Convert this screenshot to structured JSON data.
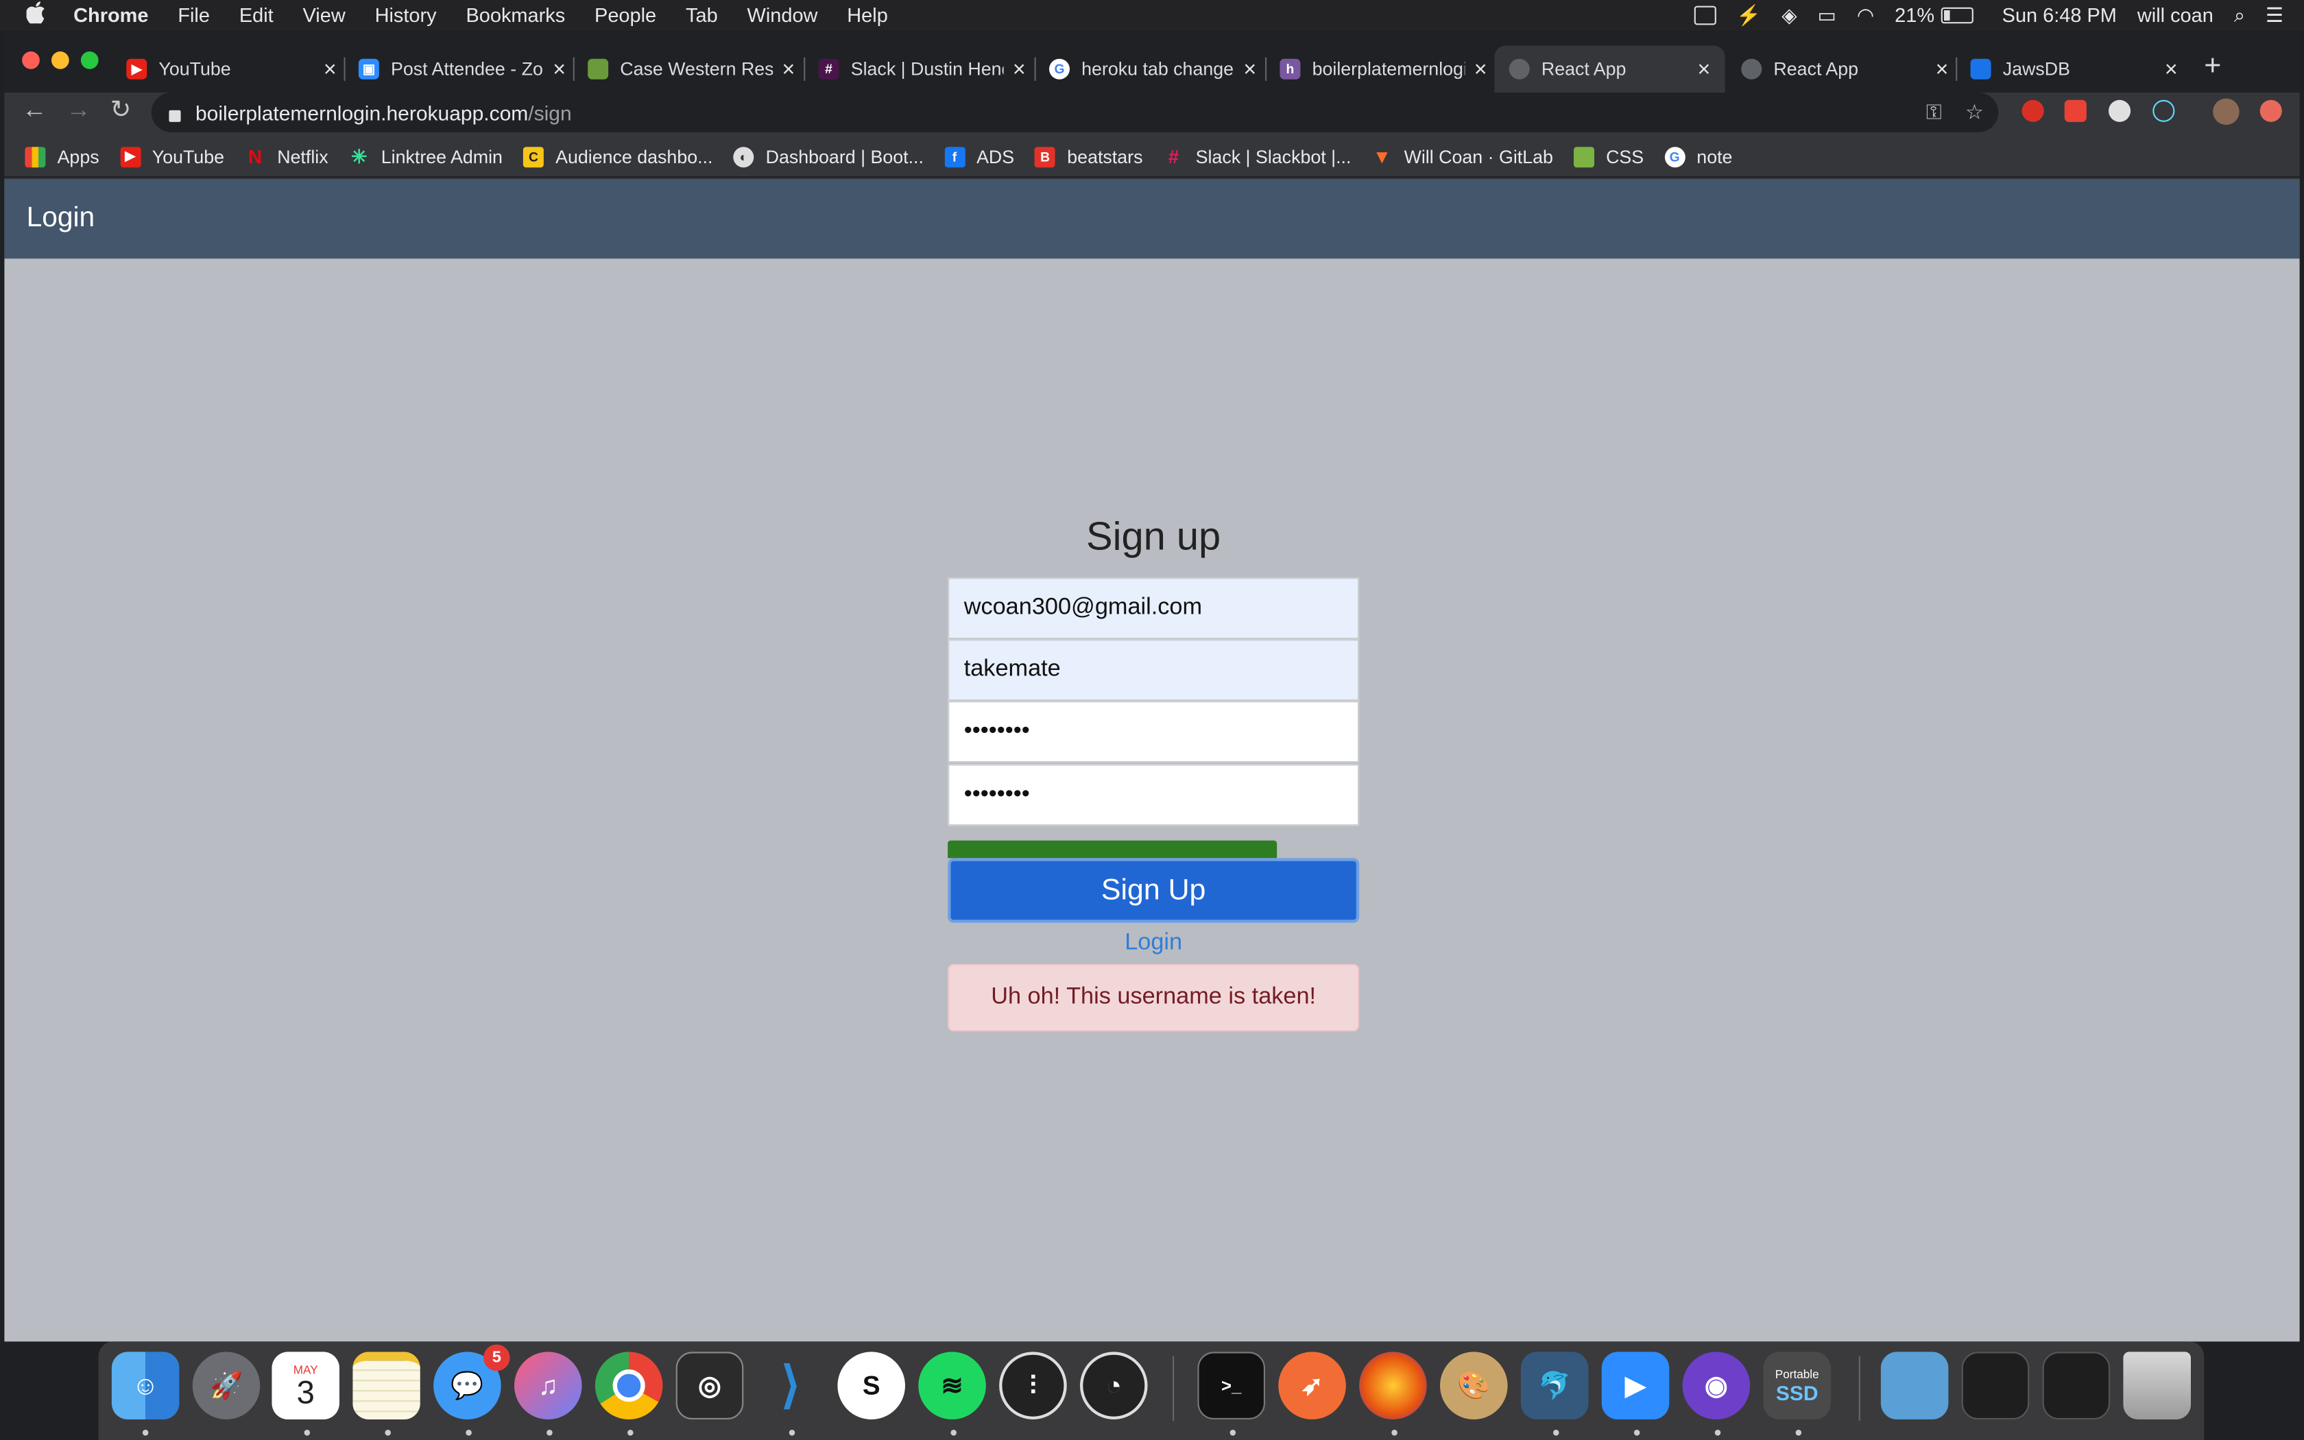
{
  "menubar": {
    "app_name": "Chrome",
    "menus": [
      "File",
      "Edit",
      "View",
      "History",
      "Bookmarks",
      "People",
      "Tab",
      "Window",
      "Help"
    ],
    "battery": "21%",
    "clock": "Sun 6:48 PM",
    "user": "will coan"
  },
  "tabs": [
    {
      "title": "YouTube",
      "icon": "youtube-icon",
      "color": "#e62117"
    },
    {
      "title": "Post Attendee - Zoom",
      "icon": "zoom-icon",
      "color": "#2d8cff"
    },
    {
      "title": "Case Western Reserve",
      "icon": "cwru-icon",
      "color": "#6a9a3a"
    },
    {
      "title": "Slack | Dustin Henderson",
      "icon": "slack-icon",
      "color": "#4a154b"
    },
    {
      "title": "heroku tab change",
      "icon": "google-icon",
      "color": "#ffffff"
    },
    {
      "title": "boilerplatemernlogin",
      "icon": "heroku-icon",
      "color": "#79589f"
    },
    {
      "title": "React App",
      "icon": "globe-icon",
      "color": "#5f6368"
    },
    {
      "title": "React App",
      "icon": "globe-icon",
      "color": "#5f6368"
    },
    {
      "title": "JawsDB",
      "icon": "jawsdb-icon",
      "color": "#1a73e8"
    }
  ],
  "address": {
    "host": "boilerplatemernlogin.herokuapp.com",
    "path": "/sign"
  },
  "bookmarks": [
    {
      "label": "Apps",
      "icon": "apps-grid-icon",
      "color": "#e8710a"
    },
    {
      "label": "YouTube",
      "icon": "youtube-icon",
      "color": "#e62117"
    },
    {
      "label": "Netflix",
      "icon": "netflix-icon",
      "color": "#e50914"
    },
    {
      "label": "Linktree Admin",
      "icon": "linktree-icon",
      "color": "#39e09b"
    },
    {
      "label": "Audience dashbo...",
      "icon": "audience-icon",
      "color": "#f5c518"
    },
    {
      "label": "Dashboard | Boot...",
      "icon": "bootstrap-icon",
      "color": "#cccccc"
    },
    {
      "label": "ADS",
      "icon": "facebook-icon",
      "color": "#1877f2"
    },
    {
      "label": "beatstars",
      "icon": "beatstars-icon",
      "color": "#e4322b"
    },
    {
      "label": "Slack | Slackbot |...",
      "icon": "slack-icon",
      "color": "#e01e5a"
    },
    {
      "label": "Will Coan · GitLab",
      "icon": "gitlab-icon",
      "color": "#fc6d26"
    },
    {
      "label": "CSS",
      "icon": "css-icon",
      "color": "#7cb342"
    },
    {
      "label": "note",
      "icon": "google-icon",
      "color": "#ffffff"
    }
  ],
  "page": {
    "brand": "Login",
    "heading": "Sign up",
    "email_value": "wcoan300@gmail.com",
    "username_value": "takemate",
    "password_mask": "••••••••",
    "confirm_mask": "••••••••",
    "submit_label": "Sign Up",
    "login_link": "Login",
    "error": "Uh oh! This username is taken!"
  },
  "dock": {
    "calendar_month": "MAY",
    "calendar_day": "3",
    "messages_badge": "5",
    "ssd_label_top": "Portable",
    "ssd_label_bottom": "SSD"
  },
  "colors": {
    "navbar": "#44566b",
    "page_bg": "#b9bcc2",
    "button": "#2167d4",
    "alert_bg": "#f2d7d9",
    "strength_bar": "#2e7d22"
  }
}
